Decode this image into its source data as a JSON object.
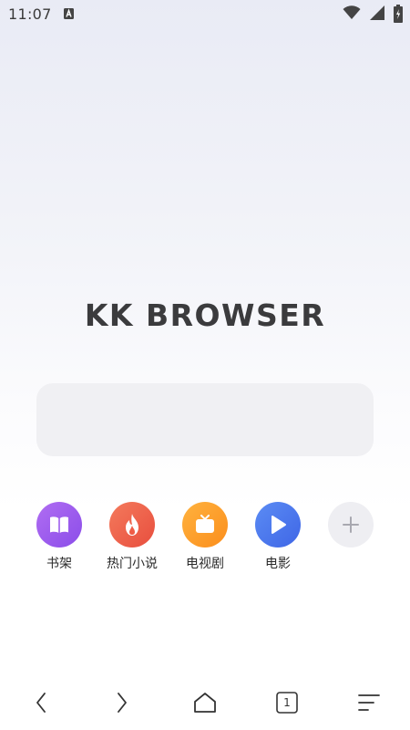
{
  "status_bar": {
    "time": "11:07",
    "icons": [
      "a-notification-icon",
      "wifi-icon",
      "signal-icon",
      "battery-charging-icon"
    ]
  },
  "logo": {
    "text": "KK BROWSER"
  },
  "search": {
    "placeholder": ""
  },
  "shortcuts": [
    {
      "label": "书架",
      "icon": "book-icon",
      "color": "#9b5cf0"
    },
    {
      "label": "热门小说",
      "icon": "fire-icon",
      "color": "#ef5d47"
    },
    {
      "label": "电视剧",
      "icon": "tv-icon",
      "color": "#fd9d2a"
    },
    {
      "label": "电影",
      "icon": "play-icon",
      "color": "#4a75ec"
    },
    {
      "label": "",
      "icon": "add-icon",
      "color": "#eeeef2"
    }
  ],
  "bottom_nav": {
    "items": [
      "back-icon",
      "forward-icon",
      "home-icon",
      "tabs-icon",
      "menu-icon"
    ],
    "tab_count": "1"
  }
}
